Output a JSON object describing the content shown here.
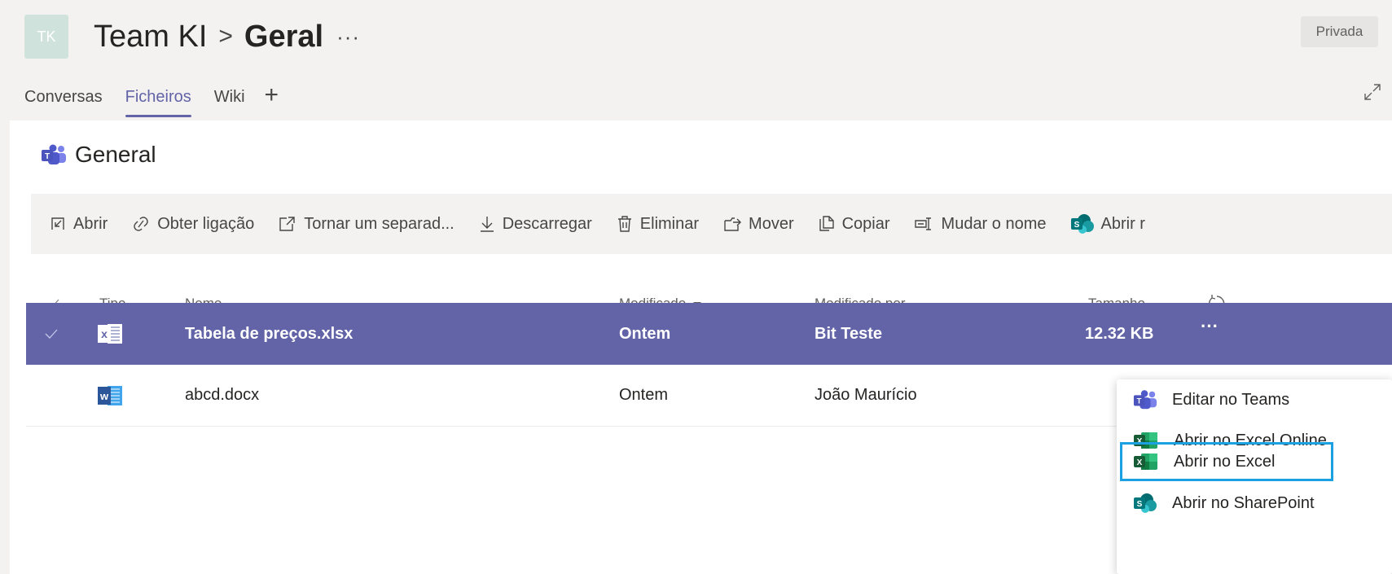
{
  "header": {
    "avatar_initials": "TK",
    "team_name": "Team KI",
    "separator": ">",
    "channel_name": "Geral",
    "more": "···",
    "privacy_badge": "Privada"
  },
  "tabs": [
    {
      "label": "Conversas"
    },
    {
      "label": "Ficheiros"
    },
    {
      "label": "Wiki"
    }
  ],
  "tab_add": "+",
  "folder": {
    "label": "General"
  },
  "toolbar": {
    "open": "Abrir",
    "get_link": "Obter ligação",
    "make_tab": "Tornar um separad...",
    "download": "Descarregar",
    "delete": "Eliminar",
    "move": "Mover",
    "copy": "Copiar",
    "rename": "Mudar o nome",
    "open_sp": "Abrir r"
  },
  "columns": {
    "type": "Tipo",
    "name": "Nome",
    "modified": "Modificado",
    "modified_by": "Modificado por",
    "size": "Tamanho"
  },
  "files": [
    {
      "icon": "excel-file-icon",
      "name": "Tabela de preços.xlsx",
      "modified": "Ontem",
      "modified_by": "Bit Teste",
      "size": "12.32 KB",
      "more": "···"
    },
    {
      "icon": "word-file-icon",
      "name": "abcd.docx",
      "modified": "Ontem",
      "modified_by": "João Maurício",
      "size": "",
      "more": ""
    }
  ],
  "context_menu": [
    {
      "icon": "teams-icon",
      "label": "Editar no Teams"
    },
    {
      "icon": "excel-icon",
      "label": "Abrir no Excel Online"
    },
    {
      "icon": "excel-icon",
      "label": "Abrir no Excel"
    },
    {
      "icon": "sharepoint-icon",
      "label": "Abrir no SharePoint"
    }
  ],
  "colors": {
    "accent": "#6264a7",
    "focus_outline": "#1ba1e2",
    "excel": "#1d6f42",
    "word": "#2b579a",
    "sharepoint": "#0b7a75"
  }
}
